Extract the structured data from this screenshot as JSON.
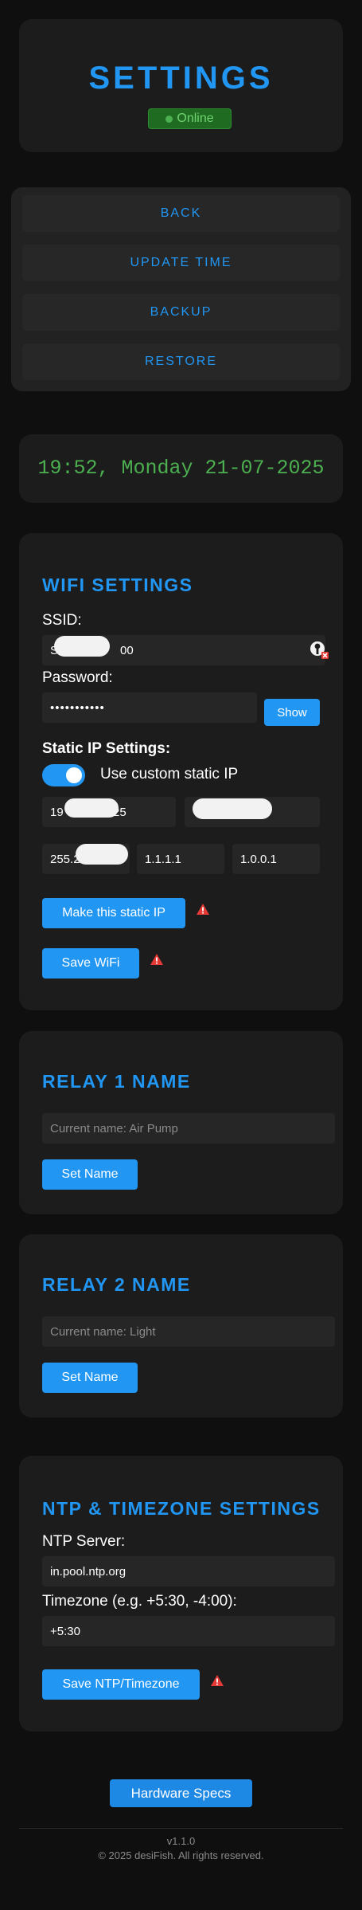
{
  "header": {
    "title": "SETTINGS",
    "status": "Online"
  },
  "nav": {
    "back": "BACK",
    "update_time": "UPDATE TIME",
    "backup": "BACKUP",
    "restore": "RESTORE"
  },
  "time": {
    "display": "19:52, Monday 21-07-2025"
  },
  "wifi": {
    "title": "WIFI SETTINGS",
    "ssid_label": "SSID:",
    "ssid_value_prefix": "S",
    "ssid_value_suffix": "00",
    "password_label": "Password:",
    "password_value": "•••••••••••",
    "show_button": "Show",
    "static_ip_label": "Static IP Settings:",
    "custom_ip_label": "Use custom static IP",
    "custom_ip_enabled": true,
    "ip_prefix": "19",
    "ip_suffix": "125",
    "subnet_prefix": "255.2",
    "dns1": "1.1.1.1",
    "dns2": "1.0.0.1",
    "make_static_button": "Make this static IP",
    "save_button": "Save WiFi"
  },
  "relay1": {
    "title": "RELAY 1 NAME",
    "placeholder": "Current name: Air Pump",
    "button": "Set Name"
  },
  "relay2": {
    "title": "RELAY 2 NAME",
    "placeholder": "Current name: Light",
    "button": "Set Name"
  },
  "ntp": {
    "title": "NTP & TIMEZONE SETTINGS",
    "server_label": "NTP Server:",
    "server_value": "in.pool.ntp.org",
    "timezone_label": "Timezone (e.g. +5:30, -4:00):",
    "timezone_value": "+5:30",
    "save_button": "Save NTP/Timezone"
  },
  "footer": {
    "hardware_button": "Hardware Specs",
    "version": "v1.1.0",
    "copyright": "© 2025 desiFish. All rights reserved."
  },
  "colors": {
    "accent": "#2196f3",
    "success": "#4caf50",
    "warning": "#e53935",
    "card": "#1c1c1c",
    "background": "#0f0f0f"
  }
}
